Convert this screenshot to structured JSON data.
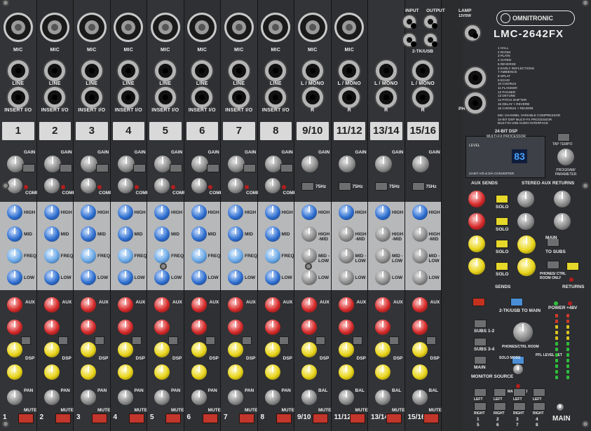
{
  "brand": {
    "name": "OMNITRONIC",
    "model": "LMC-2642FX"
  },
  "colors": {
    "panel": "#2b2c2e",
    "eq_band": "#b7b8ba",
    "mute": "#c2362b",
    "solo": "#e6d82a"
  },
  "top_labels": {
    "input": "INPUT",
    "output": "OUTPUT",
    "lamp": "LAMP",
    "lamp_spec": "12V/5W",
    "tk_usb": "2-TK/USB",
    "phones": "PHONES"
  },
  "mono_labels": {
    "mic": "MIC",
    "line": "LINE",
    "insert": "INSERT I/O"
  },
  "stereo_labels": {
    "lmono": "L / MONO",
    "r": "R"
  },
  "mono_channels": [
    "1",
    "2",
    "3",
    "4",
    "5",
    "6",
    "7",
    "8"
  ],
  "stereo_channels": [
    "9/10",
    "11/12",
    "13/14",
    "15/16"
  ],
  "strip_labels": {
    "gain": "GAIN",
    "comp": "COMP",
    "hz75": "75Hz",
    "high": "HIGH",
    "mid": "MID",
    "freq": "FREQ",
    "low": "LOW",
    "high_mid": "HIGH -MID",
    "mid_low": "MID -LOW",
    "aux": "AUX",
    "dsp": "DSP",
    "pan": "PAN",
    "bal": "BAL",
    "mute": "MUTE"
  },
  "fx": {
    "title": "24-BIT DSP",
    "subtitle": "MULTI-FX PROCESSOR",
    "display": "83",
    "footer": "24-BIT A/D & D/A CONVERTER",
    "level": "LEVEL",
    "tap": "TAP TEMPO",
    "program": "PROGRAM/ PARAMETER",
    "list": [
      "1 HALL",
      "2 ROOM",
      "3 PLATE",
      "4 GATED",
      "5 REVERSE",
      "6 EARLY REFLECTIONS",
      "7 AMBIENCE",
      "8 SPLAT",
      "9 ECHO",
      "10 CHORUS",
      "11 FLANGER",
      "12 PHASER",
      "13 DETUNE",
      "14 PITCH SHIFTER",
      "15 DELAY + REVERB",
      "16 CHORUS + REVERB"
    ],
    "notes": [
      "MIC CHANNEL VARIABLE COMPRESSOR",
      "24-BIT DSP MULTI-FX PROCESSOR",
      "BUILT-IN USB AUDIO INTERFACE"
    ]
  },
  "master": {
    "aux_sends": "AUX SENDS",
    "stereo_aux_returns": "STEREO AUX RETURNS",
    "solo": "SOLO",
    "sends": "SENDS",
    "returns": "RETURNS",
    "main": "MAIN",
    "to_subs": "TO SUBS",
    "phones_ctrl": "PHONES/ CTRL ROOM ONLY",
    "tk_to_main": "2-TK/USB TO MAIN",
    "power": "POWER",
    "phantom": "+48V",
    "subs12": "SUBS 1-2",
    "subs34": "SUBS 3-4",
    "main_btn": "MAIN",
    "monitor_source": "MONITOR SOURCE",
    "solo_mode": "SOLO MODE",
    "phones_ctrl_room": "PHONES/CTRL ROOM",
    "main_solo": "MAIN SOLO",
    "lvl_set": "PFL LEVEL SET",
    "left": "LEFT",
    "right": "RIGHT",
    "sub_numbers": [
      "1",
      "2",
      "3",
      "4"
    ],
    "right_numbers": [
      "5",
      "6",
      "7",
      "8"
    ],
    "main_label": "MAIN"
  }
}
